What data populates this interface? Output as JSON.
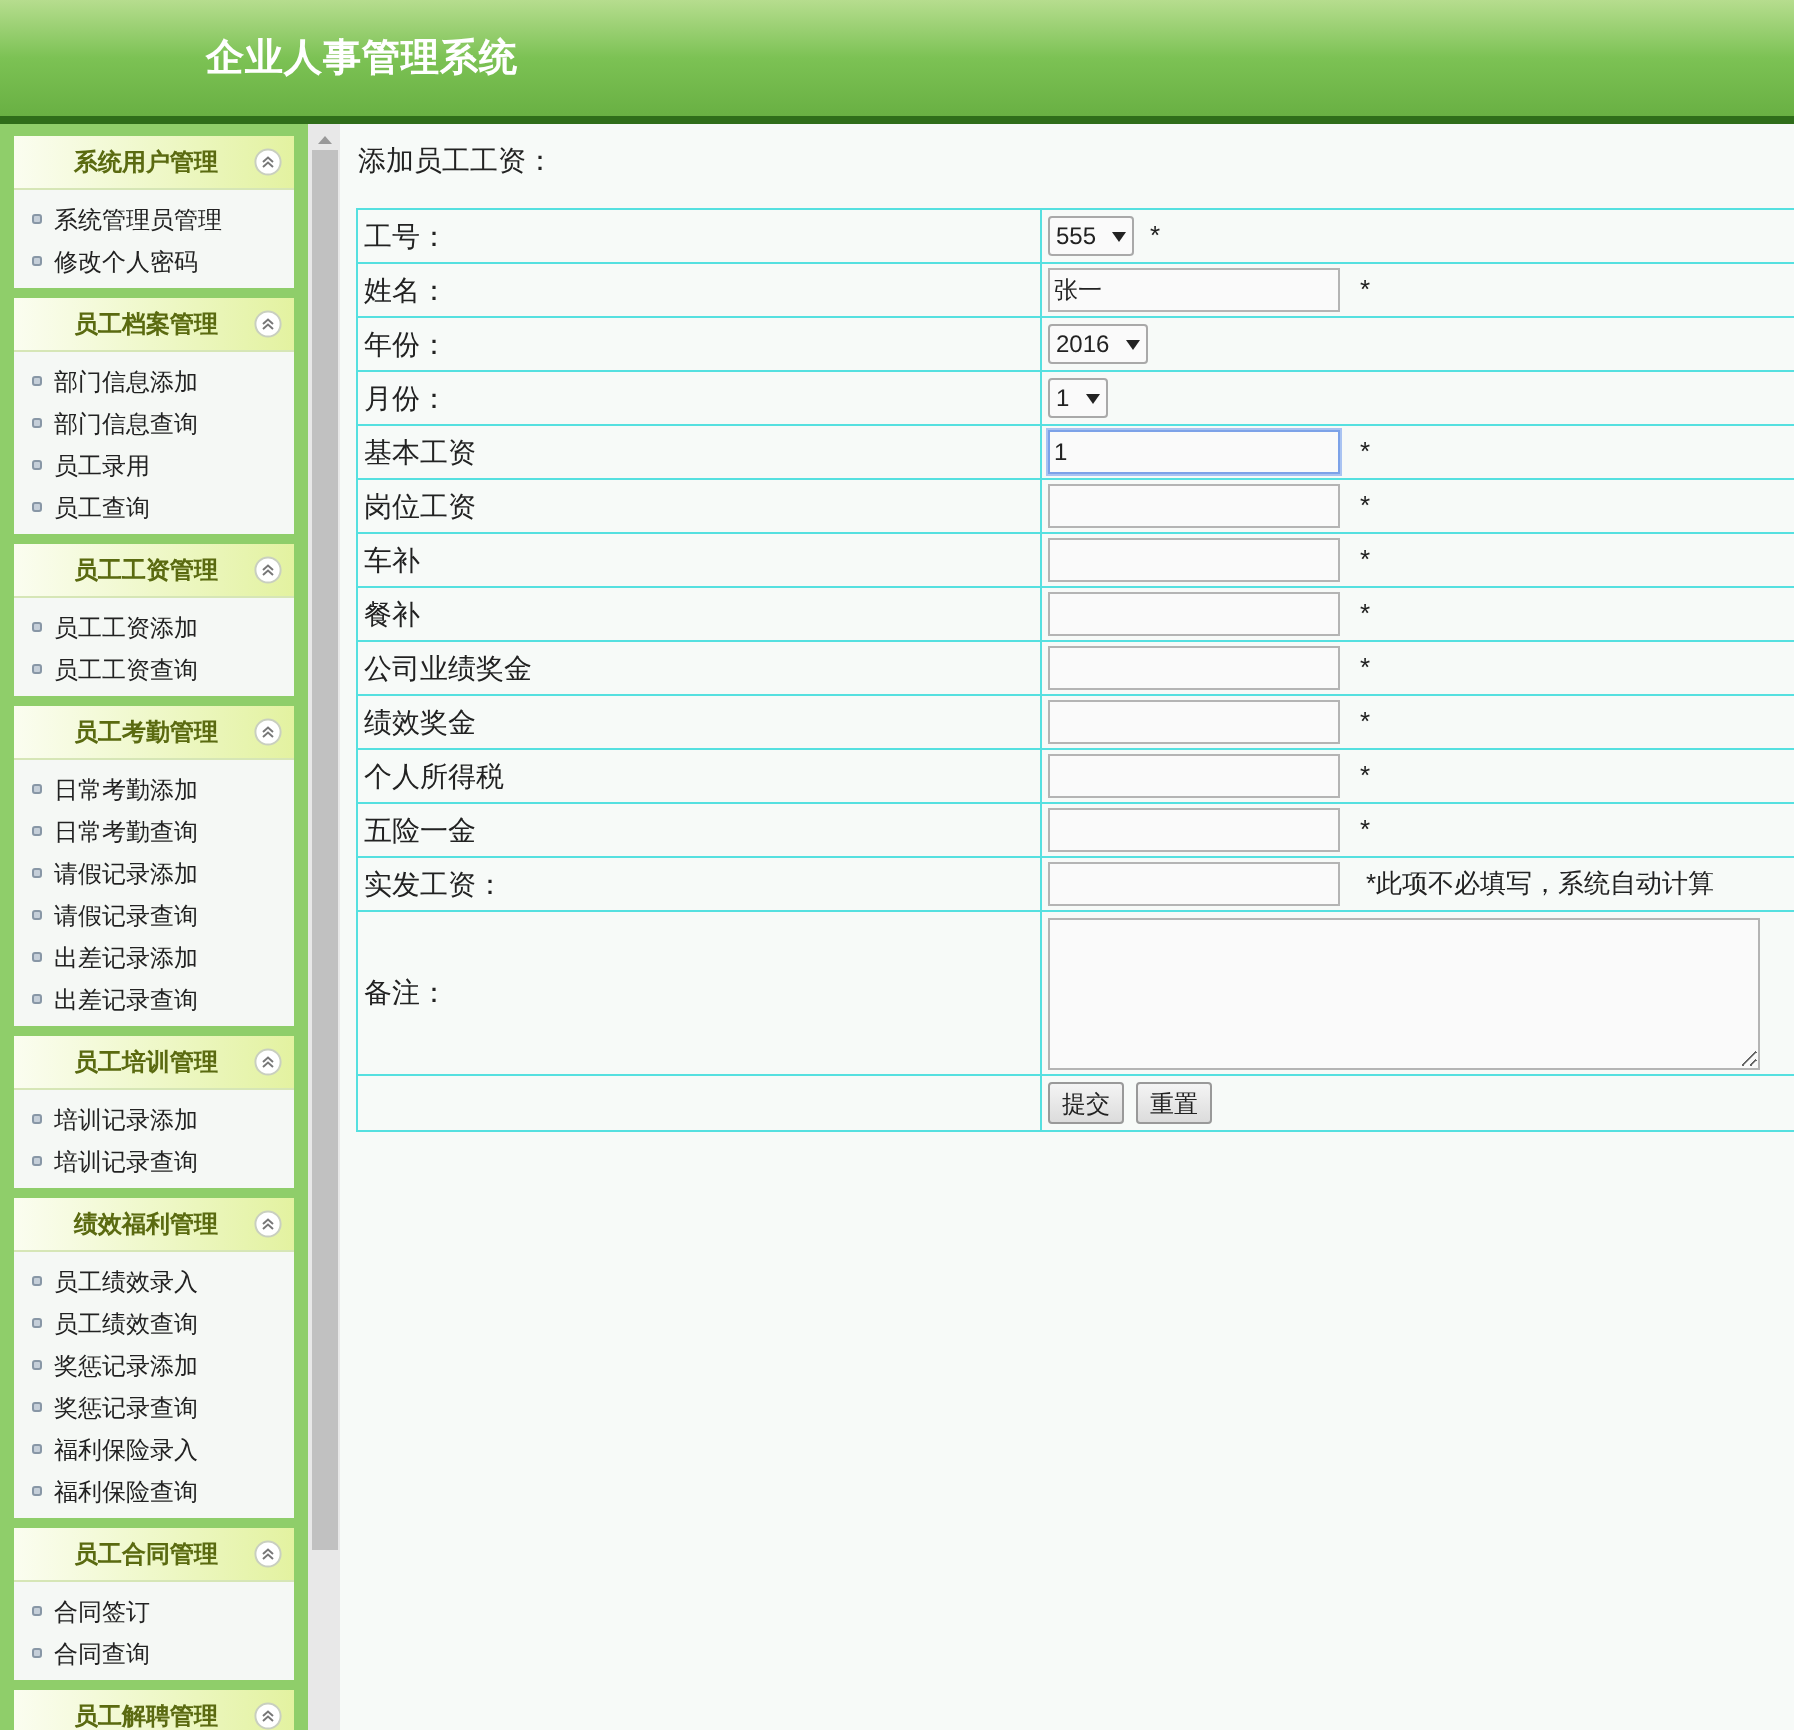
{
  "header": {
    "title": "企业人事管理系统"
  },
  "sidebar": {
    "panels": [
      {
        "title": "系统用户管理",
        "expanded": true,
        "items": [
          "系统管理员管理",
          "修改个人密码"
        ]
      },
      {
        "title": "员工档案管理",
        "expanded": true,
        "items": [
          "部门信息添加",
          "部门信息查询",
          "员工录用",
          "员工查询"
        ]
      },
      {
        "title": "员工工资管理",
        "expanded": true,
        "items": [
          "员工工资添加",
          "员工工资查询"
        ]
      },
      {
        "title": "员工考勤管理",
        "expanded": true,
        "items": [
          "日常考勤添加",
          "日常考勤查询",
          "请假记录添加",
          "请假记录查询",
          "出差记录添加",
          "出差记录查询"
        ]
      },
      {
        "title": "员工培训管理",
        "expanded": true,
        "items": [
          "培训记录添加",
          "培训记录查询"
        ]
      },
      {
        "title": "绩效福利管理",
        "expanded": true,
        "items": [
          "员工绩效录入",
          "员工绩效查询",
          "奖惩记录添加",
          "奖惩记录查询",
          "福利保险录入",
          "福利保险查询"
        ]
      },
      {
        "title": "员工合同管理",
        "expanded": true,
        "items": [
          "合同签订",
          "合同查询"
        ]
      },
      {
        "title": "员工解聘管理",
        "expanded": true
      }
    ]
  },
  "form": {
    "title": "添加员工工资：",
    "rows": [
      {
        "kind": "select",
        "label": "工号：",
        "value": "555",
        "required": "*"
      },
      {
        "kind": "text",
        "label": "姓名：",
        "value": "张一",
        "required": "*",
        "focused": false
      },
      {
        "kind": "select",
        "label": "年份：",
        "value": "2016"
      },
      {
        "kind": "select",
        "label": "月份：",
        "value": "1"
      },
      {
        "kind": "text",
        "label": "基本工资",
        "value": "1",
        "required": "*",
        "focused": true
      },
      {
        "kind": "text",
        "label": "岗位工资",
        "required": "*",
        "focused": false
      },
      {
        "kind": "text",
        "label": "车补",
        "required": "*",
        "focused": false
      },
      {
        "kind": "text",
        "label": "餐补",
        "required": "*",
        "focused": false
      },
      {
        "kind": "text",
        "label": "公司业绩奖金",
        "required": "*",
        "focused": false
      },
      {
        "kind": "text",
        "label": "绩效奖金",
        "required": "*",
        "focused": false
      },
      {
        "kind": "text",
        "label": "个人所得税",
        "required": "*",
        "focused": false
      },
      {
        "kind": "text",
        "label": "五险一金",
        "required": "*",
        "focused": false
      },
      {
        "kind": "text",
        "label": "实发工资：",
        "note": "*此项不必填写，系统自动计算",
        "focused": false
      },
      {
        "kind": "textarea",
        "label": "备注："
      },
      {
        "kind": "buttons",
        "buttons": [
          "提交",
          "重置"
        ]
      }
    ]
  }
}
